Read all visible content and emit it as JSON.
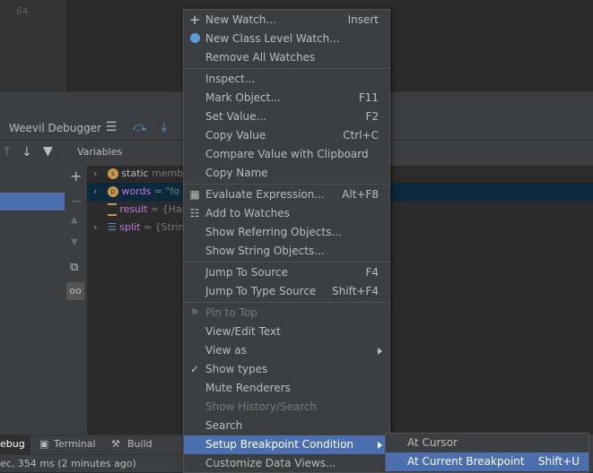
{
  "editor": {
    "line_number": "64"
  },
  "debugger": {
    "title": "Weevil Debugger",
    "variables_label": "Variables",
    "variables": [
      {
        "badge": "s",
        "name": "static",
        "value": "memb",
        "badge_color": "#c79a4b"
      },
      {
        "badge": "p",
        "name": "words",
        "value": "= \"fo",
        "badge_color": "#c79a4b"
      },
      {
        "badge": "",
        "name": "result",
        "value": "= {Has",
        "badge_color": "#c79a4b"
      },
      {
        "badge": "",
        "name": "split",
        "value": "= {Strin",
        "badge_color": "#5a9bd5"
      }
    ]
  },
  "bottom": {
    "tabs": [
      "ebug",
      "Terminal",
      "Build"
    ],
    "status": "ec, 354 ms (2 minutes ago)"
  },
  "menu": {
    "items": [
      {
        "label": "New Watch...",
        "shortcut": "Insert",
        "icon": "+"
      },
      {
        "label": "New Class Level Watch...",
        "shortcut": "",
        "icon": "class-watch-icon"
      },
      {
        "label": "Remove All Watches",
        "shortcut": ""
      },
      {
        "label": "Inspect...",
        "shortcut": ""
      },
      {
        "label": "Mark Object...",
        "shortcut": "F11"
      },
      {
        "label": "Set Value...",
        "shortcut": "F2"
      },
      {
        "label": "Copy Value",
        "shortcut": "Ctrl+C"
      },
      {
        "label": "Compare Value with Clipboard",
        "shortcut": ""
      },
      {
        "label": "Copy Name",
        "shortcut": ""
      },
      {
        "label": "Evaluate Expression...",
        "shortcut": "Alt+F8",
        "icon": "calculator-icon"
      },
      {
        "label": "Add to Watches",
        "shortcut": "",
        "icon": "watches-icon"
      },
      {
        "label": "Show Referring Objects...",
        "shortcut": ""
      },
      {
        "label": "Show String Objects...",
        "shortcut": ""
      },
      {
        "label": "Jump To Source",
        "shortcut": "F4"
      },
      {
        "label": "Jump To Type Source",
        "shortcut": "Shift+F4"
      },
      {
        "label": "Pin to Top",
        "shortcut": "",
        "disabled": true,
        "icon": "pin-icon"
      },
      {
        "label": "View/Edit Text",
        "shortcut": ""
      },
      {
        "label": "View as",
        "shortcut": "",
        "submenu": true
      },
      {
        "label": "Show types",
        "shortcut": "",
        "checked": true
      },
      {
        "label": "Mute Renderers",
        "shortcut": ""
      },
      {
        "label": "Show History/Search",
        "shortcut": "",
        "disabled": true
      },
      {
        "label": "Search",
        "shortcut": ""
      },
      {
        "label": "Setup Breakpoint Condition",
        "shortcut": "",
        "submenu": true,
        "active": true
      },
      {
        "label": "Customize Data Views...",
        "shortcut": ""
      }
    ]
  },
  "submenu": {
    "items": [
      {
        "label": "At Cursor",
        "shortcut": ""
      },
      {
        "label": "At Current Breakpoint",
        "shortcut": "Shift+U",
        "active": true
      }
    ]
  },
  "colors": {
    "accent": "#4b6eaf",
    "background": "#2b2b2b",
    "panel": "#3c3f41"
  }
}
